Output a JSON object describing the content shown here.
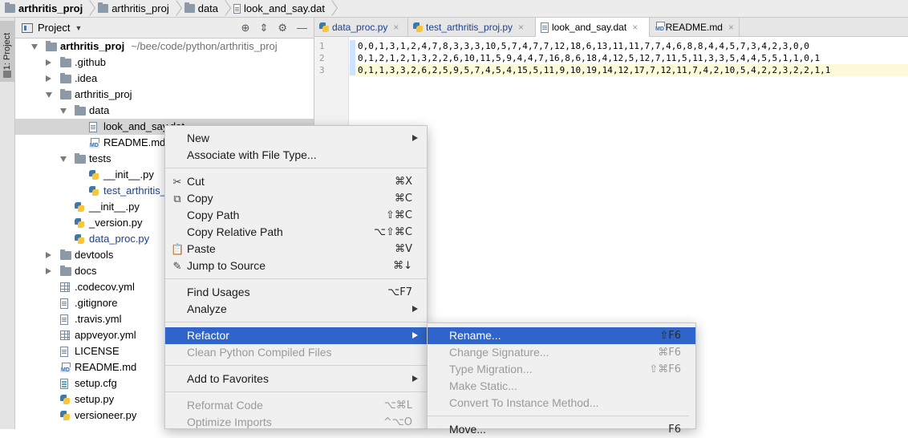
{
  "breadcrumb": [
    {
      "label": "arthritis_proj",
      "icon": "folder-icon",
      "bold": true
    },
    {
      "label": "arthritis_proj",
      "icon": "folder-icon",
      "bold": false
    },
    {
      "label": "data",
      "icon": "folder-icon",
      "bold": false
    },
    {
      "label": "look_and_say.dat",
      "icon": "file-icon",
      "bold": false
    }
  ],
  "toolstrip": {
    "project_tab": "1: Project"
  },
  "project_panel": {
    "title": "Project",
    "tree": [
      {
        "label": "arthritis_proj",
        "path": "~/bee/code/python/arthritis_proj",
        "arrow": "down",
        "icon": "folder",
        "bold": true
      },
      {
        "label": ".github",
        "arrow": "right",
        "icon": "folder"
      },
      {
        "label": ".idea",
        "arrow": "right",
        "icon": "folder"
      },
      {
        "label": "arthritis_proj",
        "arrow": "down",
        "icon": "folder"
      },
      {
        "label": "data",
        "arrow": "down",
        "icon": "folder"
      },
      {
        "label": "look_and_say.dat",
        "icon": "file",
        "selected": true
      },
      {
        "label": "README.md",
        "icon": "md"
      },
      {
        "label": "tests",
        "arrow": "down",
        "icon": "folder"
      },
      {
        "label": "__init__.py",
        "icon": "py"
      },
      {
        "label": "test_arthritis_proj.py",
        "icon": "py",
        "blue": true
      },
      {
        "label": "__init__.py",
        "icon": "py"
      },
      {
        "label": "_version.py",
        "icon": "py"
      },
      {
        "label": "data_proc.py",
        "icon": "py",
        "blue": true
      },
      {
        "label": "devtools",
        "arrow": "right",
        "icon": "folder"
      },
      {
        "label": "docs",
        "arrow": "right",
        "icon": "folder"
      },
      {
        "label": ".codecov.yml",
        "icon": "grid"
      },
      {
        "label": ".gitignore",
        "icon": "file"
      },
      {
        "label": ".travis.yml",
        "icon": "file"
      },
      {
        "label": "appveyor.yml",
        "icon": "grid"
      },
      {
        "label": "LICENSE",
        "icon": "file"
      },
      {
        "label": "README.md",
        "icon": "md"
      },
      {
        "label": "setup.cfg",
        "icon": "cfg"
      },
      {
        "label": "setup.py",
        "icon": "py"
      },
      {
        "label": "versioneer.py",
        "icon": "py"
      }
    ]
  },
  "tabs": [
    {
      "label": "data_proc.py",
      "icon": "py"
    },
    {
      "label": "test_arthritis_proj.py",
      "icon": "py"
    },
    {
      "label": "look_and_say.dat",
      "icon": "file",
      "active": true
    },
    {
      "label": "README.md",
      "icon": "md"
    }
  ],
  "editor": {
    "line_numbers": [
      "1",
      "2",
      "3"
    ],
    "lines": [
      "0,0,1,3,1,2,4,7,8,3,3,3,10,5,7,4,7,7,12,18,6,13,11,11,7,7,4,6,8,8,4,4,5,7,3,4,2,3,0,0",
      "0,1,2,1,2,1,3,2,2,6,10,11,5,9,4,4,7,16,8,6,18,4,12,5,12,7,11,5,11,3,3,5,4,4,5,5,1,1,0,1",
      "0,1,1,3,3,2,6,2,5,9,5,7,4,5,4,15,5,11,9,10,19,14,12,17,7,12,11,7,4,2,10,5,4,2,2,3,2,2,1,1"
    ]
  },
  "context_menu": {
    "items": [
      {
        "label": "New",
        "submenu": true
      },
      {
        "label": "Associate with File Type..."
      },
      {
        "sep": true
      },
      {
        "label": "Cut",
        "shortcut": "⌘X",
        "icon": "✂"
      },
      {
        "label": "Copy",
        "shortcut": "⌘C",
        "icon": "⧉"
      },
      {
        "label": "Copy Path",
        "shortcut": "⇧⌘C"
      },
      {
        "label": "Copy Relative Path",
        "shortcut": "⌥⇧⌘C"
      },
      {
        "label": "Paste",
        "shortcut": "⌘V",
        "icon": "📋"
      },
      {
        "label": "Jump to Source",
        "shortcut": "⌘↓",
        "icon": "✎"
      },
      {
        "sep": true
      },
      {
        "label": "Find Usages",
        "shortcut": "⌥F7"
      },
      {
        "label": "Analyze",
        "submenu": true
      },
      {
        "sep": true
      },
      {
        "label": "Refactor",
        "submenu": true,
        "highlighted": true
      },
      {
        "label": "Clean Python Compiled Files",
        "disabled": true
      },
      {
        "sep": true
      },
      {
        "label": "Add to Favorites",
        "submenu": true
      },
      {
        "sep": true
      },
      {
        "label": "Reformat Code",
        "shortcut": "⌥⌘L",
        "disabled": true
      },
      {
        "label": "Optimize Imports",
        "shortcut": "^⌥O",
        "disabled": true
      }
    ]
  },
  "refactor_submenu": {
    "items": [
      {
        "label": "Rename...",
        "shortcut": "⇧F6",
        "highlighted": true
      },
      {
        "label": "Change Signature...",
        "shortcut": "⌘F6",
        "disabled": true
      },
      {
        "label": "Type Migration...",
        "shortcut": "⇧⌘F6",
        "disabled": true
      },
      {
        "label": "Make Static...",
        "disabled": true
      },
      {
        "label": "Convert To Instance Method...",
        "disabled": true
      },
      {
        "sep": true
      },
      {
        "label": "Move...",
        "shortcut": "F6"
      }
    ]
  },
  "colors": {
    "selection": "#2f65ca",
    "changed_line_marker": "#cfe2ff",
    "current_line": "#fcfad9"
  }
}
